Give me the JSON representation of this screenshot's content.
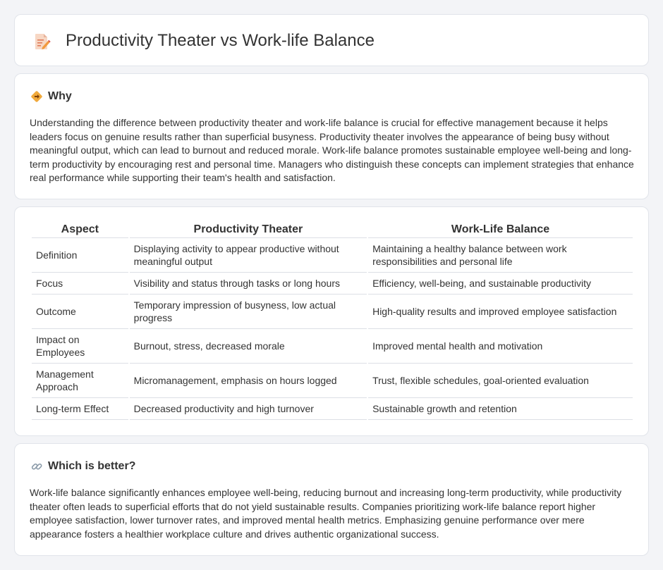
{
  "header": {
    "title": "Productivity Theater vs Work-life Balance",
    "icon": "document-pencil-icon"
  },
  "why": {
    "title": "Why",
    "icon": "diamond-directions-icon",
    "text": "Understanding the difference between productivity theater and work-life balance is crucial for effective management because it helps leaders focus on genuine results rather than superficial busyness. Productivity theater involves the appearance of being busy without meaningful output, which can lead to burnout and reduced morale. Work-life balance promotes sustainable employee well-being and long-term productivity by encouraging rest and personal time. Managers who distinguish these concepts can implement strategies that enhance real performance while supporting their team's health and satisfaction."
  },
  "table": {
    "headers": [
      "Aspect",
      "Productivity Theater",
      "Work-Life Balance"
    ],
    "rows": [
      [
        "Definition",
        "Displaying activity to appear productive without meaningful output",
        "Maintaining a healthy balance between work responsibilities and personal life"
      ],
      [
        "Focus",
        "Visibility and status through tasks or long hours",
        "Efficiency, well-being, and sustainable productivity"
      ],
      [
        "Outcome",
        "Temporary impression of busyness, low actual progress",
        "High-quality results and improved employee satisfaction"
      ],
      [
        "Impact on Employees",
        "Burnout, stress, decreased morale",
        "Improved mental health and motivation"
      ],
      [
        "Management Approach",
        "Micromanagement, emphasis on hours logged",
        "Trust, flexible schedules, goal-oriented evaluation"
      ],
      [
        "Long-term Effect",
        "Decreased productivity and high turnover",
        "Sustainable growth and retention"
      ]
    ]
  },
  "better": {
    "title": "Which is better?",
    "icon": "link-icon",
    "text": "Work-life balance significantly enhances employee well-being, reducing burnout and increasing long-term productivity, while productivity theater often leads to superficial efforts that do not yield sustainable results. Companies prioritizing work-life balance report higher employee satisfaction, lower turnover rates, and improved mental health metrics. Emphasizing genuine performance over mere appearance fosters a healthier workplace culture and drives authentic organizational success."
  }
}
